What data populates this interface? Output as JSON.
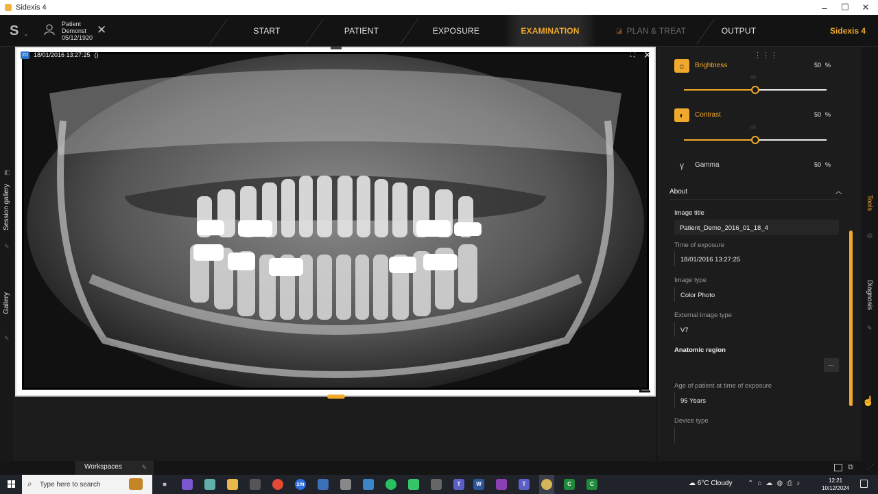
{
  "window": {
    "title": "Sidexis 4",
    "controls": [
      "–",
      "☐",
      "✕"
    ]
  },
  "patient": {
    "line1": "Patient",
    "line2": "Demonst",
    "dob": "05/12/1920"
  },
  "nav": {
    "tabs": [
      {
        "label": "START",
        "state": "normal"
      },
      {
        "label": "PATIENT",
        "state": "normal"
      },
      {
        "label": "EXPOSURE",
        "state": "normal"
      },
      {
        "label": "EXAMINATION",
        "state": "active"
      },
      {
        "label": "PLAN & TREAT",
        "state": "disabled"
      },
      {
        "label": "OUTPUT",
        "state": "normal"
      }
    ],
    "brand": "Sidexis 4"
  },
  "left_rail": {
    "tabs": [
      "Session gallery",
      "Gallery"
    ]
  },
  "viewer": {
    "badge": "2D",
    "timestamp": "18/01/2016 13:27:25",
    "extra": "()",
    "image_kind": "panoramic dental x-ray"
  },
  "adjustments": {
    "brightness": {
      "label": "Brightness",
      "value": "50",
      "unit": "%",
      "level": 0.5,
      "icon": "sun-icon"
    },
    "contrast": {
      "label": "Contrast",
      "value": "50",
      "unit": "%",
      "level": 0.5,
      "icon": "contrast-icon"
    },
    "gamma": {
      "label": "Gamma",
      "value": "50",
      "unit": "%",
      "icon": "gamma-icon"
    }
  },
  "about": {
    "header": "About",
    "image_title_label": "Image title",
    "image_title_value": "Patient_Demo_2016_01_18_4",
    "time_label": "Time of exposure",
    "time_value": "18/01/2016 13:27:25",
    "type_label": "Image type",
    "type_value": "Color Photo",
    "ext_type_label": "External image type",
    "ext_type_value": "V7",
    "anatomic_label": "Anatomic region",
    "anatomic_btn": "...",
    "age_label": "Age of patient at time of exposure",
    "age_value": "95 Years",
    "device_label": "Device type",
    "device_value": ""
  },
  "right_rail": {
    "tabs": [
      "Tools",
      "Diagnosis"
    ]
  },
  "bottom": {
    "workspaces": "Workspaces"
  },
  "taskbar": {
    "search_placeholder": "Type here to search",
    "weather": "6°C  Cloudy",
    "time": "12:21",
    "date": "10/12/2024",
    "colors": {
      "bg": "#20232a",
      "accent": "#f0a92c"
    }
  }
}
